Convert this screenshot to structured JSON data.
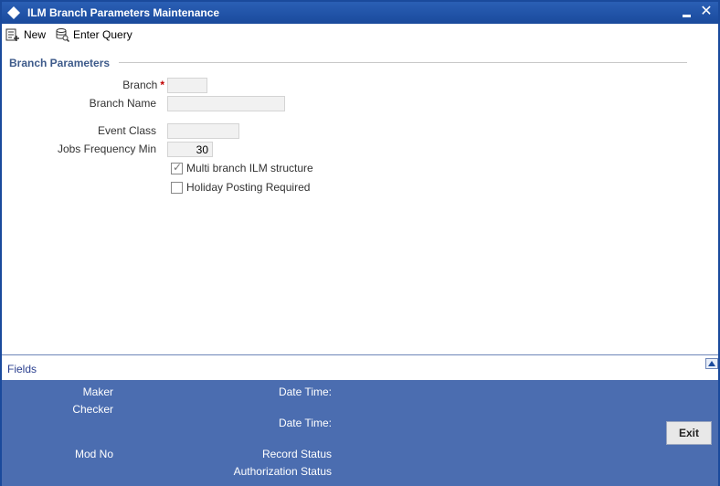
{
  "window": {
    "title": "ILM Branch Parameters Maintenance",
    "close_glyph": "✕"
  },
  "toolbar": {
    "new_label": "New",
    "enter_query_label": "Enter Query"
  },
  "section": {
    "title": "Branch Parameters"
  },
  "form": {
    "branch_label": "Branch",
    "branch_required": "*",
    "branch_value": "",
    "branch_name_label": "Branch Name",
    "branch_name_value": "",
    "event_class_label": "Event Class",
    "event_class_value": "",
    "jobs_freq_label": "Jobs Frequency Min",
    "jobs_freq_value": "30",
    "multi_branch_label": "Multi branch ILM structure",
    "multi_branch_checked": true,
    "holiday_posting_label": "Holiday Posting Required",
    "holiday_posting_checked": false
  },
  "fields_bar": {
    "label": "Fields"
  },
  "audit": {
    "maker_label": "Maker",
    "checker_label": "Checker",
    "date_time_label_1": "Date Time:",
    "date_time_label_2": "Date Time:",
    "mod_no_label": "Mod No",
    "record_status_label": "Record Status",
    "authorization_status_label": "Authorization Status",
    "exit_label": "Exit"
  },
  "colors": {
    "titlebar": "#1a4a9c",
    "footer": "#4b6db0",
    "section_title": "#3d5a8a",
    "required": "#c00000"
  }
}
